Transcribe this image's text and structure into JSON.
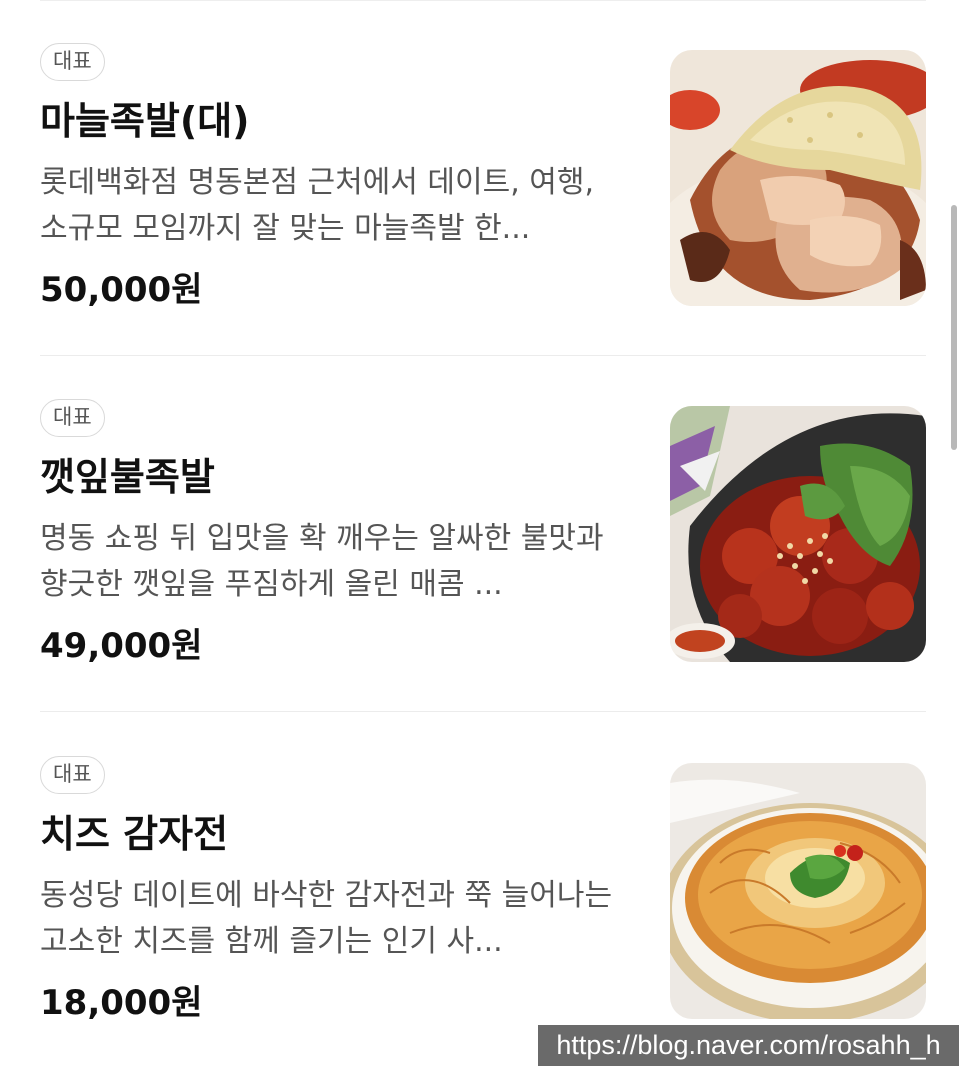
{
  "menu": {
    "items": [
      {
        "badge": "대표",
        "name": "마늘족발(대)",
        "description": "롯데백화점 명동본점 근처에서 데이트, 여행, 소규모 모임까지 잘 맞는 마늘족발 한...",
        "price": "50,000원",
        "image": "garlic-jokbal-photo"
      },
      {
        "badge": "대표",
        "name": "깻잎불족발",
        "description": "명동 쇼핑 뒤 입맛을 확 깨우는 알싸한 불맛과 향긋한 깻잎을 푸짐하게 올린 매콤 ...",
        "price": "49,000원",
        "image": "spicy-perilla-jokbal-photo"
      },
      {
        "badge": "대표",
        "name": "치즈 감자전",
        "description": "동성당 데이트에 바삭한 감자전과 쭉 늘어나는 고소한 치즈를 함께 즐기는 인기 사...",
        "price": "18,000원",
        "image": "cheese-potato-pancake-photo"
      }
    ]
  },
  "watermark": {
    "text": "https://blog.naver.com/rosahh_h"
  }
}
